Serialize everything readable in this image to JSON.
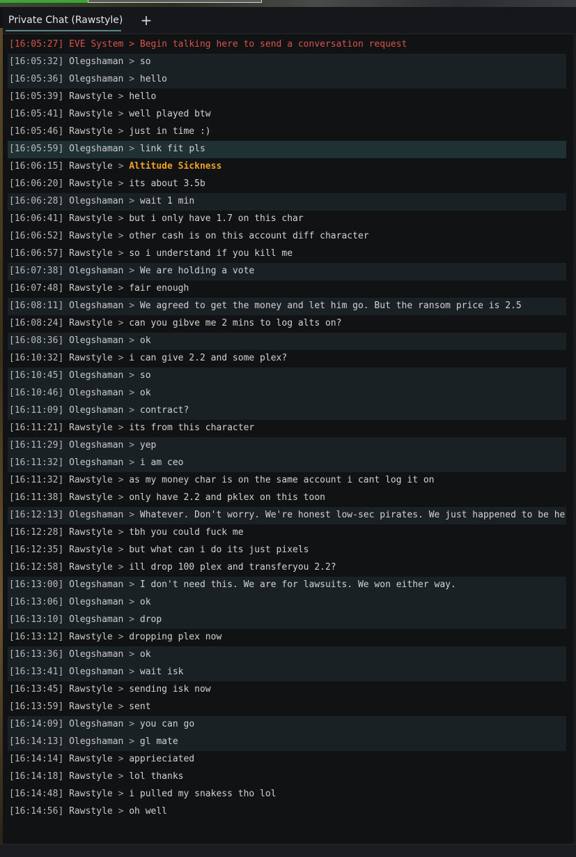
{
  "window": {
    "tab_label": "Private Chat (Rawstyle)",
    "add_tab_label": "+"
  },
  "messages": [
    {
      "time": "[16:05:27]",
      "sender": "EVE System",
      "text": "Begin talking here to send a conversation request",
      "style": "system"
    },
    {
      "time": "[16:05:32]",
      "sender": "Olegshaman",
      "text": "so",
      "style": "alt"
    },
    {
      "time": "[16:05:36]",
      "sender": "Olegshaman",
      "text": "hello",
      "style": "alt"
    },
    {
      "time": "[16:05:39]",
      "sender": "Rawstyle",
      "text": "hello",
      "style": ""
    },
    {
      "time": "[16:05:41]",
      "sender": "Rawstyle",
      "text": "well played btw",
      "style": ""
    },
    {
      "time": "[16:05:46]",
      "sender": "Rawstyle",
      "text": "just in time :)",
      "style": ""
    },
    {
      "time": "[16:05:59]",
      "sender": "Olegshaman",
      "text": "link fit pls",
      "style": "hl"
    },
    {
      "time": "[16:06:15]",
      "sender": "Rawstyle",
      "text": "Altitude Sickness",
      "style": "",
      "link": true
    },
    {
      "time": "[16:06:20]",
      "sender": "Rawstyle",
      "text": "its about 3.5b",
      "style": ""
    },
    {
      "time": "[16:06:28]",
      "sender": "Olegshaman",
      "text": "wait 1 min",
      "style": "alt"
    },
    {
      "time": "[16:06:41]",
      "sender": "Rawstyle",
      "text": "but i only have 1.7 on this char",
      "style": ""
    },
    {
      "time": "[16:06:52]",
      "sender": "Rawstyle",
      "text": "other cash is on this account diff character",
      "style": ""
    },
    {
      "time": "[16:06:57]",
      "sender": "Rawstyle",
      "text": "so i understand if you kill me",
      "style": ""
    },
    {
      "time": "[16:07:38]",
      "sender": "Olegshaman",
      "text": "We are holding a vote",
      "style": "alt"
    },
    {
      "time": "[16:07:48]",
      "sender": "Rawstyle",
      "text": "fair enough",
      "style": ""
    },
    {
      "time": "[16:08:11]",
      "sender": "Olegshaman",
      "text": "We agreed to get the money and let him go. But the ransom price is 2.5",
      "style": "alt"
    },
    {
      "time": "[16:08:24]",
      "sender": "Rawstyle",
      "text": "can  you gibve me 2 mins to log alts on?",
      "style": ""
    },
    {
      "time": "[16:08:36]",
      "sender": "Olegshaman",
      "text": "ok",
      "style": "alt"
    },
    {
      "time": "[16:10:32]",
      "sender": "Rawstyle",
      "text": "i can give 2.2 and some plex?",
      "style": ""
    },
    {
      "time": "[16:10:45]",
      "sender": "Olegshaman",
      "text": "so",
      "style": "alt"
    },
    {
      "time": "[16:10:46]",
      "sender": "Olegshaman",
      "text": "ok",
      "style": "alt"
    },
    {
      "time": "[16:11:09]",
      "sender": "Olegshaman",
      "text": "contract?",
      "style": "alt"
    },
    {
      "time": "[16:11:21]",
      "sender": "Rawstyle",
      "text": "its from this character",
      "style": ""
    },
    {
      "time": "[16:11:29]",
      "sender": "Olegshaman",
      "text": "yep",
      "style": "alt"
    },
    {
      "time": "[16:11:32]",
      "sender": "Olegshaman",
      "text": "i am ceo",
      "style": "alt"
    },
    {
      "time": "[16:11:32]",
      "sender": "Rawstyle",
      "text": "as my money char is on the same account i cant log it on",
      "style": ""
    },
    {
      "time": "[16:11:38]",
      "sender": "Rawstyle",
      "text": "only have 2.2 and pklex on this toon",
      "style": ""
    },
    {
      "time": "[16:12:13]",
      "sender": "Olegshaman",
      "text": "Whatever. Don't worry. We're honest low-sec pirates. We just happened to be here.",
      "style": "alt"
    },
    {
      "time": "[16:12:28]",
      "sender": "Rawstyle",
      "text": "tbh you could fuck me",
      "style": ""
    },
    {
      "time": "[16:12:35]",
      "sender": "Rawstyle",
      "text": "but what can i do its just pixels",
      "style": ""
    },
    {
      "time": "[16:12:58]",
      "sender": "Rawstyle",
      "text": "ill drop 100 plex and transferyou 2.2?",
      "style": ""
    },
    {
      "time": "[16:13:00]",
      "sender": "Olegshaman",
      "text": "I don't need this. We are for lawsuits. We won either way.",
      "style": "alt"
    },
    {
      "time": "[16:13:06]",
      "sender": "Olegshaman",
      "text": "ok",
      "style": "alt"
    },
    {
      "time": "[16:13:10]",
      "sender": "Olegshaman",
      "text": "drop",
      "style": "alt"
    },
    {
      "time": "[16:13:12]",
      "sender": "Rawstyle",
      "text": "dropping plex now",
      "style": ""
    },
    {
      "time": "[16:13:36]",
      "sender": "Olegshaman",
      "text": "ok",
      "style": "alt"
    },
    {
      "time": "[16:13:41]",
      "sender": "Olegshaman",
      "text": "wait isk",
      "style": "alt"
    },
    {
      "time": "[16:13:45]",
      "sender": "Rawstyle",
      "text": "sending isk now",
      "style": ""
    },
    {
      "time": "[16:13:59]",
      "sender": "Rawstyle",
      "text": "sent",
      "style": ""
    },
    {
      "time": "[16:14:09]",
      "sender": "Olegshaman",
      "text": "you can go",
      "style": "alt"
    },
    {
      "time": "[16:14:13]",
      "sender": "Olegshaman",
      "text": "gl mate",
      "style": "alt"
    },
    {
      "time": "[16:14:14]",
      "sender": "Rawstyle",
      "text": "apprieciated",
      "style": ""
    },
    {
      "time": "[16:14:18]",
      "sender": "Rawstyle",
      "text": "lol thanks",
      "style": ""
    },
    {
      "time": "[16:14:48]",
      "sender": "Rawstyle",
      "text": "i pulled my snakess tho lol",
      "style": ""
    },
    {
      "time": "[16:14:56]",
      "sender": "Rawstyle",
      "text": "oh well",
      "style": ""
    }
  ],
  "separator": ">",
  "colors": {
    "background": "#111214",
    "system_text": "#d9534b",
    "link_text": "#f0a023",
    "alt_row": "#1a2125",
    "highlight_row": "#1f3133"
  }
}
